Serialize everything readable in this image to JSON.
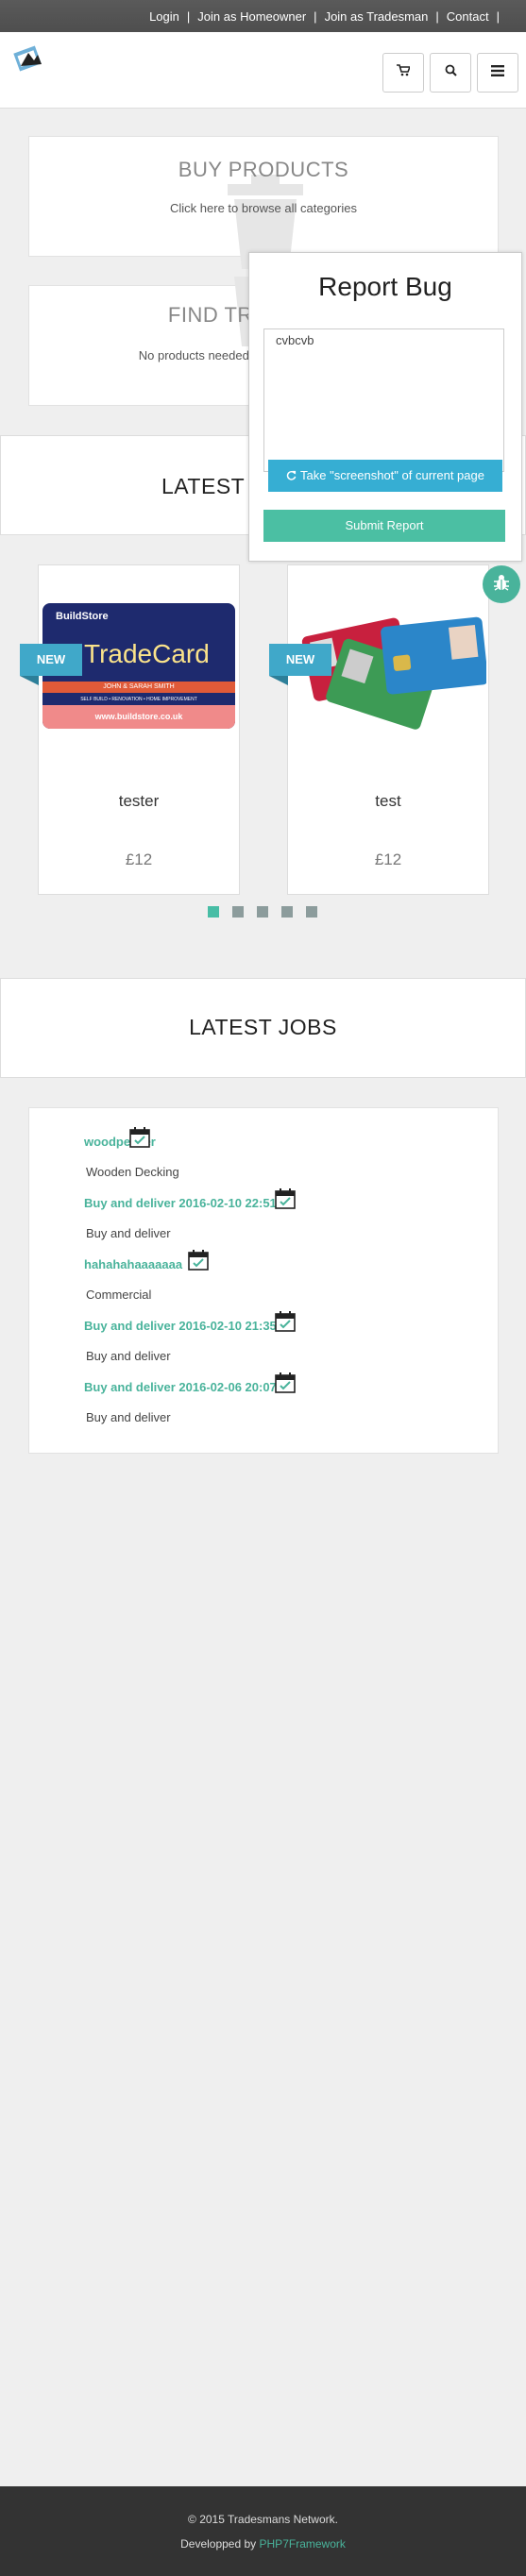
{
  "topnav": {
    "login": "Login",
    "sep": "|",
    "join_homeowner": "Join as Homeowner",
    "join_tradesman": "Join as Tradesman",
    "contact": "Contact"
  },
  "header": {
    "cart_icon": "cart-icon",
    "search_icon": "search-icon",
    "menu_icon": "menu-icon"
  },
  "buy_products": {
    "title": "BUY PRODUCTS",
    "subtitle": "Click here to browse all categories"
  },
  "find_tradesman": {
    "title": "FIND TRADESMAN",
    "subtitle": "No products needed, only tradesmen services"
  },
  "latest_products": {
    "title": "LATEST"
  },
  "products": [
    {
      "name": "tester",
      "price": "£12",
      "badge": "NEW",
      "image": {
        "brand": "BuildStore",
        "headline": "TradeCard",
        "names": "JOHN & SARAH SMITH",
        "tagline": "SELF BUILD • RENOVATION • HOME IMPROVEMENT",
        "url": "www.buildstore.co.uk"
      }
    },
    {
      "name": "test",
      "price": "£12",
      "badge": "NEW"
    }
  ],
  "carousel": {
    "count": 5,
    "active": 0
  },
  "latest_jobs": {
    "title": "LATEST JOBS",
    "items": [
      {
        "title": "woodpecker",
        "desc": "Wooden Decking"
      },
      {
        "title": "Buy and deliver 2016-02-10 22:51:06",
        "desc": "Buy and deliver"
      },
      {
        "title": "hahahahaaaaaaa",
        "desc": "Commercial"
      },
      {
        "title": "Buy and deliver 2016-02-10 21:35:11",
        "desc": "Buy and deliver"
      },
      {
        "title": "Buy and deliver 2016-02-06 20:07:29",
        "desc": "Buy and deliver"
      }
    ]
  },
  "report_bug": {
    "title": "Report Bug",
    "text": "cvbcvb",
    "screenshot_label": "Take \"screenshot\" of current page",
    "submit_label": "Submit Report"
  },
  "footer": {
    "copyright": "© 2015 Tradesmans Network.",
    "developed_prefix": "Developped by",
    "developed_link": "PHP7Framework"
  },
  "colors": {
    "accent": "#49b39b",
    "blue": "#36aed3",
    "topbar": "#555555",
    "footer": "#333333"
  }
}
